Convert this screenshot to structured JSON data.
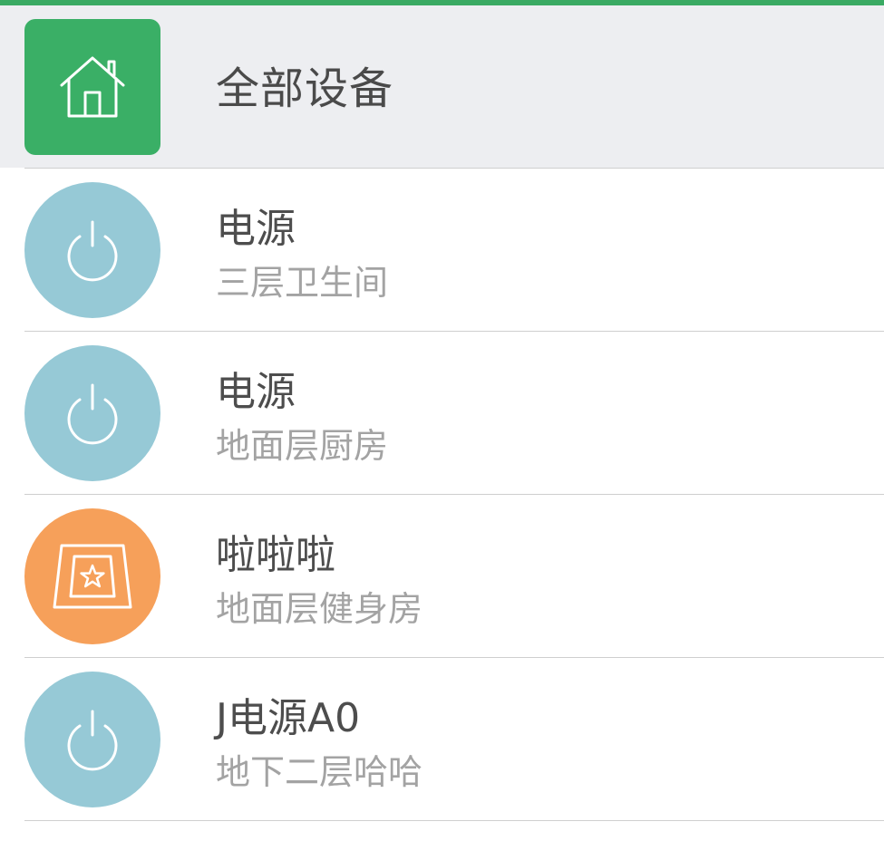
{
  "header": {
    "title": "全部设备",
    "icon": "house-icon",
    "icon_bg": "#3aaf66"
  },
  "devices": [
    {
      "name": "电源",
      "location": "三层卫生间",
      "icon": "power-icon",
      "icon_bg": "#96c9d6"
    },
    {
      "name": "电源",
      "location": "地面层厨房",
      "icon": "power-icon",
      "icon_bg": "#96c9d6"
    },
    {
      "name": "啦啦啦",
      "location": "地面层健身房",
      "icon": "carpet-star-icon",
      "icon_bg": "#f6a05a"
    },
    {
      "name": "J电源A0",
      "location": "地下二层哈哈",
      "icon": "power-icon",
      "icon_bg": "#96c9d6"
    }
  ],
  "colors": {
    "accent": "#3aaa63",
    "header_bg": "#edeef1",
    "primary_text": "#4d4d4d",
    "secondary_text": "#a3a3a3"
  }
}
